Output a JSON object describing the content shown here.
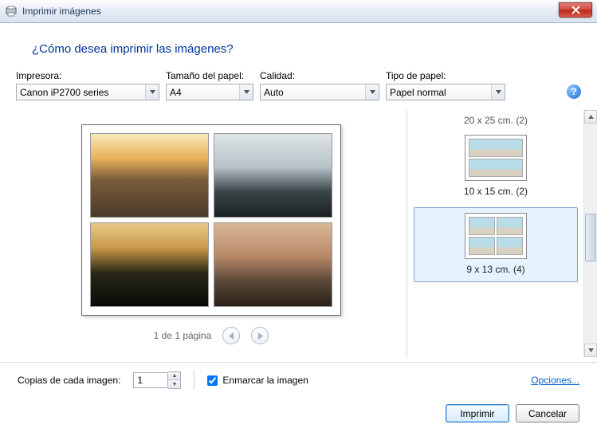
{
  "window": {
    "title": "Imprimir imágenes"
  },
  "heading": "¿Cómo desea imprimir las imágenes?",
  "fields": {
    "printer": {
      "label": "Impresora:",
      "value": "Canon iP2700 series"
    },
    "paper_size": {
      "label": "Tamaño del papel:",
      "value": "A4"
    },
    "quality": {
      "label": "Calidad:",
      "value": "Auto"
    },
    "paper_type": {
      "label": "Tipo de papel:",
      "value": "Papel normal"
    }
  },
  "preview": {
    "page_text": "1 de 1 página"
  },
  "layouts": {
    "cutoff_label": "20 x 25 cm. (2)",
    "items": [
      {
        "label": "10 x 15 cm. (2)"
      },
      {
        "label": "9 x 13 cm. (4)"
      }
    ]
  },
  "copies": {
    "label": "Copias de cada imagen:",
    "value": "1"
  },
  "frame": {
    "label": "Enmarcar la imagen",
    "checked": true
  },
  "options_link": "Opciones...",
  "buttons": {
    "print": "Imprimir",
    "cancel": "Cancelar"
  }
}
